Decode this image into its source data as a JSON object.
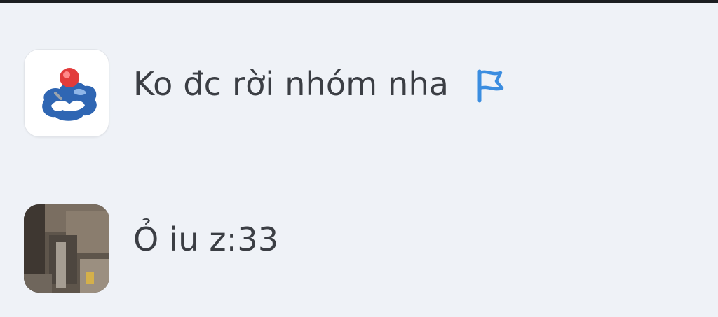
{
  "conversations": [
    {
      "name": "Ko đc rời nhóm nha",
      "avatar_icon": "group-logo-icon",
      "badge_icon": "flag-icon",
      "badge_color": "#3b8de0"
    },
    {
      "name": "Ỏ iu z:33",
      "avatar_icon": "photo-avatar"
    }
  ]
}
